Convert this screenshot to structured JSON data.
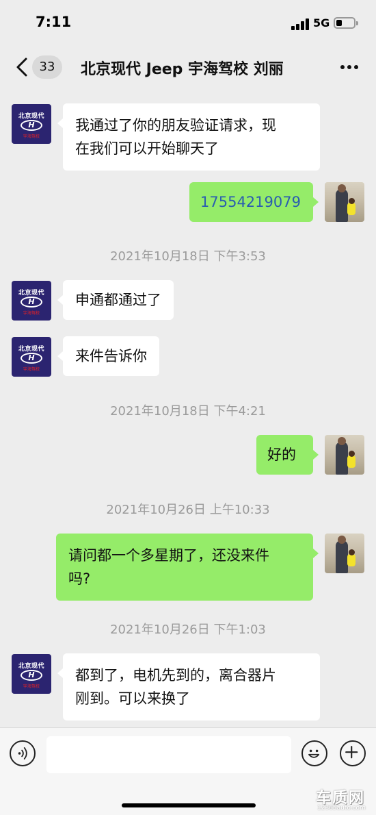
{
  "status_bar": {
    "time": "7:11",
    "network": "5G"
  },
  "nav": {
    "unread_count": "33",
    "title": "北京现代 Jeep 宇海驾校 刘丽"
  },
  "avatar_brand": {
    "top_text": "北京现代",
    "logo_letter": "H",
    "sub_text": "宇海驾校"
  },
  "messages": [
    {
      "side": "left",
      "text_line1": "我通过了你的朋友验证请求，现",
      "text_line2": "在我们可以开始聊天了"
    },
    {
      "side": "right",
      "text": "17554219079"
    },
    {
      "type": "timestamp",
      "text": "2021年10月18日 下午3:53"
    },
    {
      "side": "left",
      "text": "申通都通过了"
    },
    {
      "side": "left",
      "text": "来件告诉你"
    },
    {
      "type": "timestamp",
      "text": "2021年10月18日 下午4:21"
    },
    {
      "side": "right",
      "text": "好的"
    },
    {
      "type": "timestamp",
      "text": "2021年10月26日 上午10:33"
    },
    {
      "side": "right",
      "text_line1": "请问都一个多星期了，还没来件",
      "text_line2": "吗?"
    },
    {
      "type": "timestamp",
      "text": "2021年10月26日 下午1:03"
    },
    {
      "side": "left",
      "text_line1": "都到了，电机先到的，离合器片",
      "text_line2": "刚到。可以来换了"
    }
  ],
  "input": {
    "value": "",
    "placeholder": ""
  },
  "icons": {
    "back": "chevron-left-icon",
    "more": "more-icon",
    "voice": "voice-icon",
    "emoji": "emoji-icon",
    "plus": "plus-icon"
  },
  "watermark": {
    "main": "车质网",
    "sub": "12365auto.com"
  },
  "colors": {
    "background": "#ededed",
    "bubble_left": "#ffffff",
    "bubble_right": "#95ec69",
    "phone_link": "#2a5db0",
    "timestamp": "#9a9a9a",
    "brand_avatar": "#2b2470"
  }
}
